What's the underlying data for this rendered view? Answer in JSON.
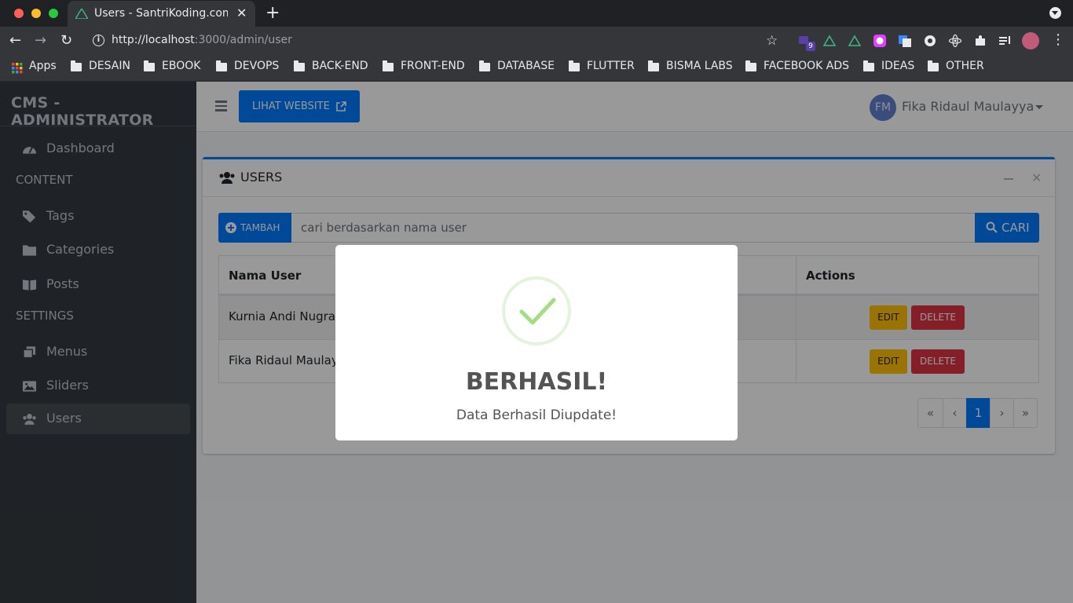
{
  "browser": {
    "tab_title": "Users - SantriKoding.com",
    "url_host": "http://localhost",
    "url_path": ":3000/admin/user",
    "extension_badge": "9",
    "bookmarks": [
      {
        "label": "Apps",
        "icon": "apps-grid-icon"
      },
      {
        "label": "DESAIN",
        "icon": "folder-icon"
      },
      {
        "label": "EBOOK",
        "icon": "folder-icon"
      },
      {
        "label": "DEVOPS",
        "icon": "folder-icon"
      },
      {
        "label": "BACK-END",
        "icon": "folder-icon"
      },
      {
        "label": "FRONT-END",
        "icon": "folder-icon"
      },
      {
        "label": "DATABASE",
        "icon": "folder-icon"
      },
      {
        "label": "FLUTTER",
        "icon": "folder-icon"
      },
      {
        "label": "BISMA LABS",
        "icon": "folder-icon"
      },
      {
        "label": "FACEBOOK ADS",
        "icon": "folder-icon"
      },
      {
        "label": "IDEAS",
        "icon": "folder-icon"
      },
      {
        "label": "OTHER",
        "icon": "folder-icon"
      }
    ]
  },
  "sidebar": {
    "brand": "CMS - ADMINISTRATOR",
    "dashboard": "Dashboard",
    "content_header": "CONTENT",
    "tags": "Tags",
    "categories": "Categories",
    "posts": "Posts",
    "settings_header": "SETTINGS",
    "menus": "Menus",
    "sliders": "Sliders",
    "users": "Users",
    "active_item": "Users"
  },
  "topnav": {
    "lihat_website": "LIHAT WEBSITE",
    "avatar_initials": "FM",
    "user_name": "Fika Ridaul Maulayya"
  },
  "card": {
    "title": "USERS",
    "tambah_label": "TAMBAH",
    "search_placeholder": "cari berdasarkan nama user",
    "cari_label": "CARI",
    "table": {
      "headers": {
        "name": "Nama User",
        "actions": "Actions"
      },
      "rows": [
        {
          "name": "Kurnia Andi Nugra"
        },
        {
          "name": "Fika Ridaul Maulay"
        }
      ],
      "edit_label": "EDIT",
      "delete_label": "DELETE"
    },
    "pagination": {
      "first": "«",
      "prev": "‹",
      "current": "1",
      "next": "›",
      "last": "»"
    }
  },
  "modal": {
    "title": "BERHASIL!",
    "text": "Data Berhasil Diupdate!",
    "icon": "success-check-icon"
  },
  "colors": {
    "primary": "#007bff",
    "warning": "#ffc107",
    "danger": "#dc3545",
    "sidebar": "#343a40",
    "success_check": "#a5dc86"
  }
}
